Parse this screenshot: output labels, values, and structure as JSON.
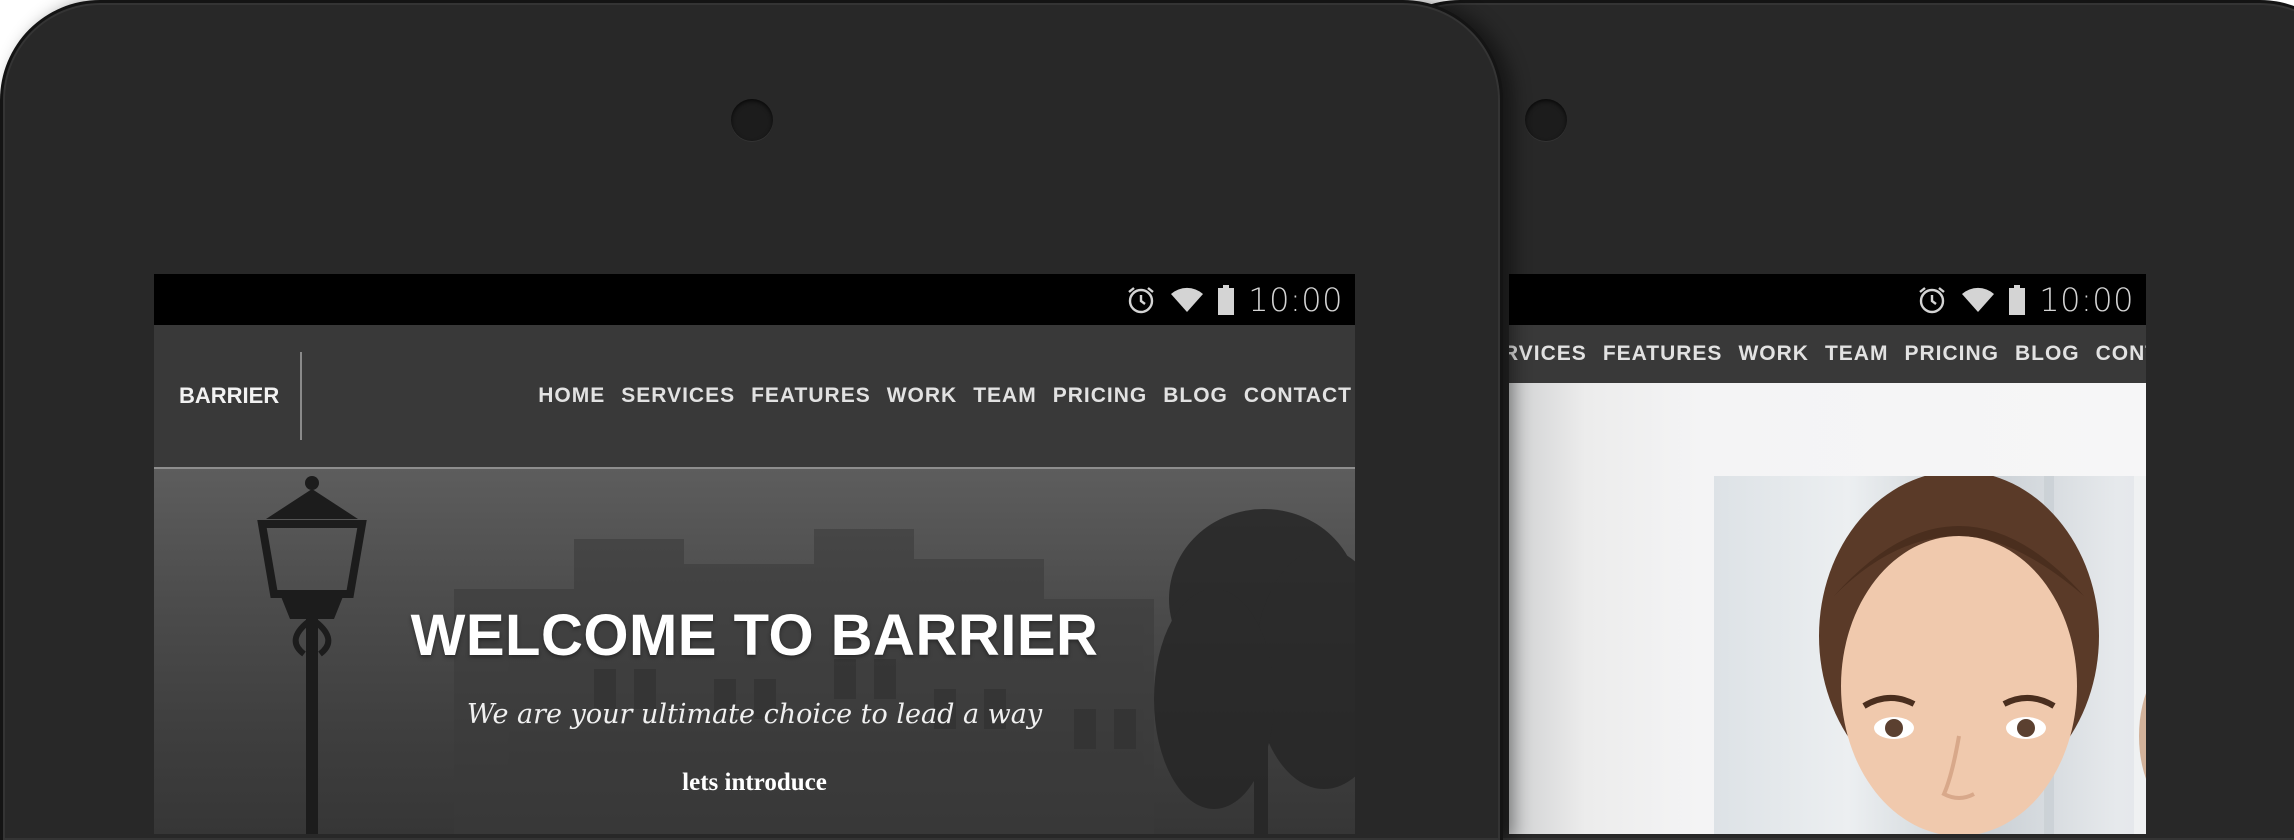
{
  "status_bar": {
    "time": "10:00",
    "icons": [
      "alarm-icon",
      "wifi-icon",
      "battery-icon"
    ]
  },
  "front_tablet": {
    "brand": "BARRIER",
    "nav": [
      "HOME",
      "SERVICES",
      "FEATURES",
      "WORK",
      "TEAM",
      "PRICING",
      "BLOG",
      "CONTACT"
    ],
    "hero": {
      "title": "WELCOME TO BARRIER",
      "subtitle": "We are your ultimate choice to lead a way",
      "cta": "lets introduce"
    }
  },
  "back_tablet": {
    "nav": [
      "RVICES",
      "FEATURES",
      "WORK",
      "TEAM",
      "PRICING",
      "BLOG",
      "CONTACT"
    ]
  },
  "colors": {
    "bezel": "#282828",
    "navbar": "#393939",
    "statusbar": "#000000",
    "nav_text": "#e2e2e2"
  }
}
